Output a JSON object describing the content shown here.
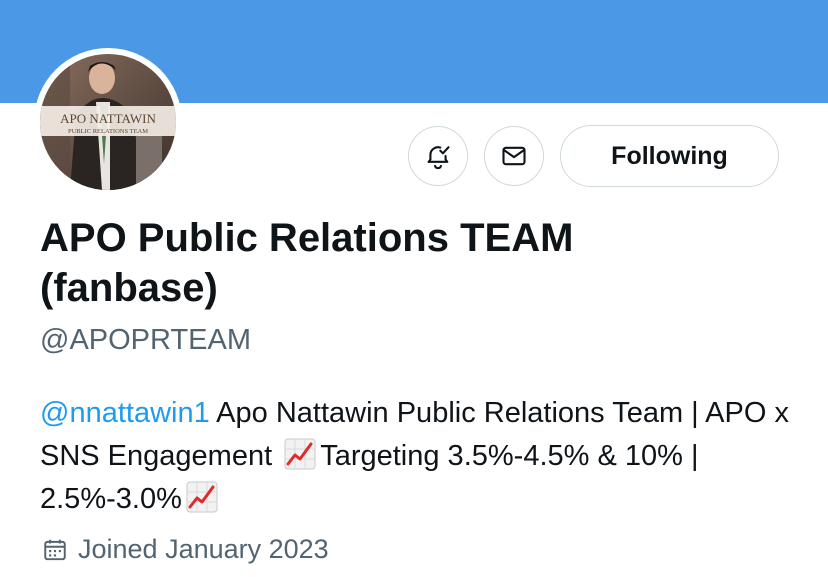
{
  "profile": {
    "display_name": "APO Public Relations TEAM (fanbase)",
    "handle": "@APOPRTEAM",
    "avatar": {
      "line1": "APO NATTAWIN",
      "line2": "PUBLIC RELATIONS TEAM"
    },
    "bio": {
      "mention": "@nnattawin1",
      "text1": " Apo Nattawin Public Relations Team | APO x SNS Engagement ",
      "text2": "Targeting 3.5%-4.5% & 10% | 2.5%-3.0%",
      "emoji_icon": "chart-increasing-icon"
    },
    "joined": "Joined January 2023"
  },
  "actions": {
    "notify_icon": "bell-check-icon",
    "message_icon": "envelope-icon",
    "following_label": "Following"
  },
  "colors": {
    "banner": "#4a98e6",
    "mention": "#1d9bf0",
    "secondary_text": "#536471",
    "border": "#cfd9de"
  }
}
